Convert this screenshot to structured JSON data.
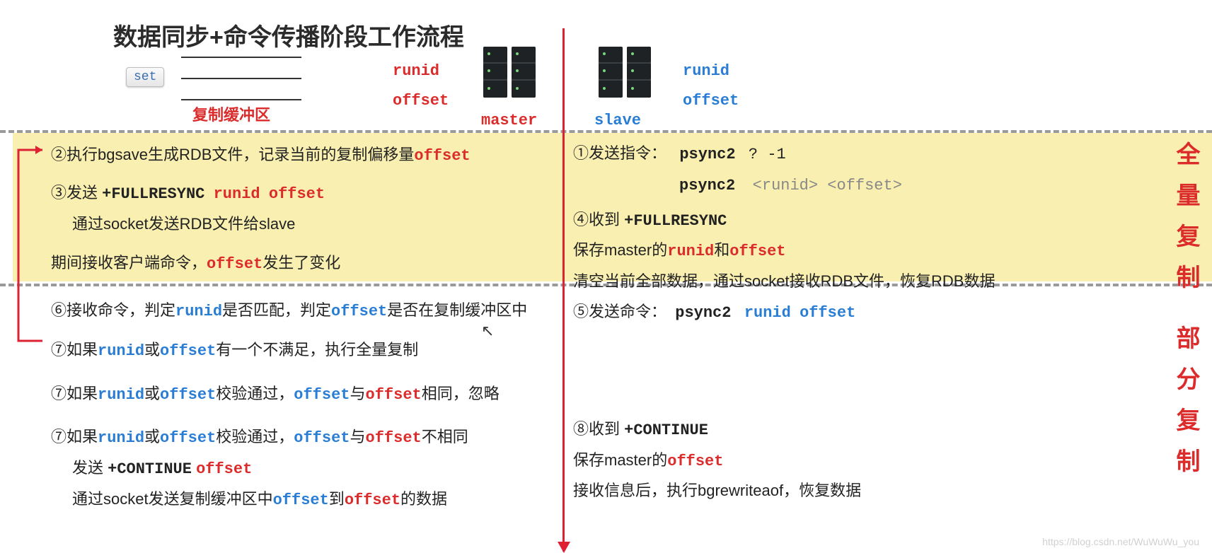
{
  "title": "数据同步+命令传播阶段工作流程",
  "set_label": "set",
  "buffer_label": "复制缓冲区",
  "master": {
    "runid": "runid",
    "offset": "offset",
    "role": "master"
  },
  "slave": {
    "runid": "runid",
    "offset": "offset",
    "role": "slave"
  },
  "side": {
    "full": "全量复制",
    "partial": "部分复制"
  },
  "left": {
    "s2a": "②执行bgsave生成RDB文件，记录当前的复制偏移量",
    "s2a_kw": "offset",
    "s3a": "③发送 ",
    "s3b": "+FULLRESYNC",
    "s3c_runid": "runid",
    "s3c_offset": "offset",
    "s3d": "通过socket发送RDB文件给slave",
    "mid": "期间接收客户端命令，",
    "mid_kw": "offset",
    "mid2": "发生了变化",
    "s6a": "⑥接收命令，判定",
    "s6_runid": "runid",
    "s6m": "是否匹配，判定",
    "s6_offset": "offset",
    "s6e": "是否在复制缓冲区中",
    "s7a": "⑦如果",
    "s7runid": "runid",
    "s7or": "或",
    "s7offset": "offset",
    "s7a2": "有一个不满足，执行全量复制",
    "s7b": "⑦如果",
    "s7b2": "校验通过，",
    "s7b_off1": "offset",
    "s7b_and": "与",
    "s7b_off2": "offset",
    "s7b3": "相同，忽略",
    "s7c": "⑦如果",
    "s7c2": "校验通过，",
    "s7c3": "不相同",
    "s7c_send": "发送 ",
    "s7c_cont": "+CONTINUE",
    "s7c_off": "offset",
    "s7c_sock": "通过socket发送复制缓冲区中",
    "s7c_to": "到",
    "s7c_data": "的数据"
  },
  "right": {
    "s1a": "①发送指令：",
    "s1cmd": "psync2",
    "s1args": "?  -1",
    "s1cmd2": "psync2",
    "s1args2": "<runid> <offset>",
    "s4a": "④收到 ",
    "s4b": "+FULLRESYNC",
    "s4c": "保存master的",
    "s4runid": "runid",
    "s4and": "和",
    "s4offset": "offset",
    "s4d": "清空当前全部数据，通过socket接收RDB文件，恢复RDB数据",
    "s5a": "⑤发送命令：",
    "s5cmd": "psync2",
    "s5args_runid": "runid",
    "s5args_offset": "offset",
    "s8a": "⑧收到 ",
    "s8b": "+CONTINUE",
    "s8c": "保存master的",
    "s8offset": "offset",
    "s8d": "接收信息后，执行bgrewriteaof，恢复数据"
  },
  "watermark": "https://blog.csdn.net/WuWuWu_you"
}
